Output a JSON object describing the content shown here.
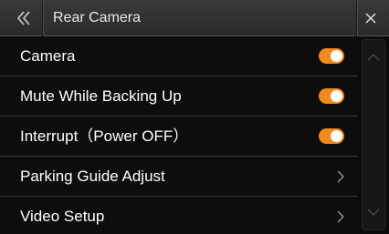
{
  "header": {
    "title": "Rear Camera",
    "back_icon": "double-chevron-left-icon",
    "close_icon": "close-icon"
  },
  "rows": [
    {
      "label": "Camera",
      "control": "toggle",
      "state": "on"
    },
    {
      "label": "Mute While Backing Up",
      "control": "toggle",
      "state": "on"
    },
    {
      "label": "Interrupt（Power OFF）",
      "control": "toggle",
      "state": "on"
    },
    {
      "label": "Parking Guide Adjust",
      "control": "chevron"
    },
    {
      "label": "Video Setup",
      "control": "chevron"
    }
  ],
  "colors": {
    "toggle_on": "#f08a1c",
    "background": "#0b0b0b",
    "header": "#333333"
  }
}
